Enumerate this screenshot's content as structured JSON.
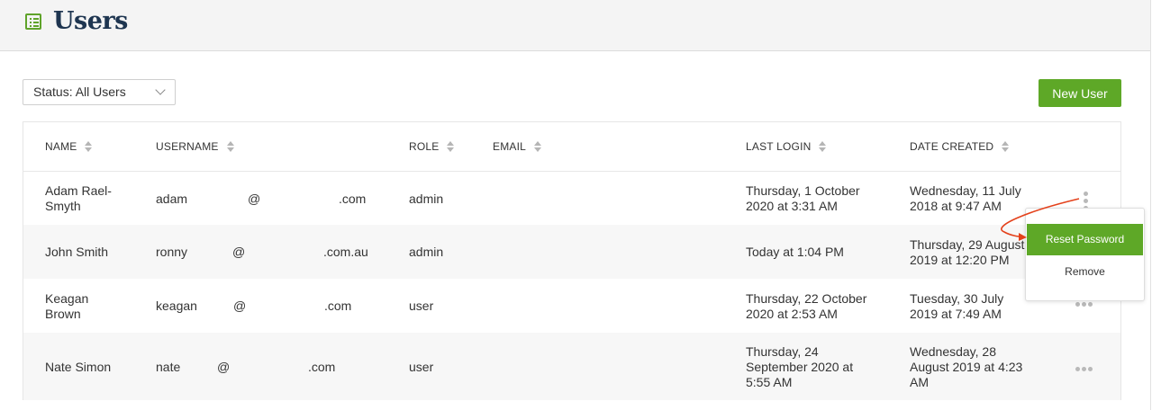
{
  "page": {
    "title": "Users"
  },
  "toolbar": {
    "status_filter": "Status: All Users",
    "new_user_label": "New User"
  },
  "table": {
    "columns": [
      "NAME",
      "USERNAME",
      "ROLE",
      "EMAIL",
      "LAST LOGIN",
      "DATE CREATED"
    ],
    "rows": [
      {
        "name": [
          "Adam Rael-",
          "Smyth"
        ],
        "user": "adam",
        "at": "@",
        "domain": ".com",
        "role": "admin",
        "last_login": [
          "Thursday, 1 October",
          "2020 at 3:31 AM"
        ],
        "created": [
          "Wednesday, 11 July",
          "2018 at 9:47 AM"
        ]
      },
      {
        "name": [
          "John Smith"
        ],
        "user": "ronny",
        "at": "@",
        "domain": ".com.au",
        "role": "admin",
        "last_login": [
          "Today at 1:04 PM"
        ],
        "created": [
          "Thursday, 29 August",
          "2019 at 12:20 PM"
        ]
      },
      {
        "name": [
          "Keagan",
          "Brown"
        ],
        "user": "keagan",
        "at": "@",
        "domain": ".com",
        "role": "user",
        "last_login": [
          "Thursday, 22 October",
          "2020 at 2:53 AM"
        ],
        "created": [
          "Tuesday, 30 July",
          "2019 at 7:49 AM"
        ]
      },
      {
        "name": [
          "Nate Simon"
        ],
        "user": "nate",
        "at": "@",
        "domain": ".com",
        "role": "user",
        "last_login": [
          "Thursday, 24",
          "September 2020 at",
          "5:55 AM"
        ],
        "created": [
          "Wednesday, 28",
          "August 2019 at 4:23",
          "AM"
        ]
      }
    ]
  },
  "menu": {
    "reset_password": "Reset Password",
    "remove": "Remove"
  },
  "colors": {
    "accent": "#5ea827",
    "title": "#1e3550",
    "annotation_arrow": "#e4411b"
  },
  "icons": {
    "logo": "list-icon",
    "row_actions": "more-horizontal-icon"
  }
}
